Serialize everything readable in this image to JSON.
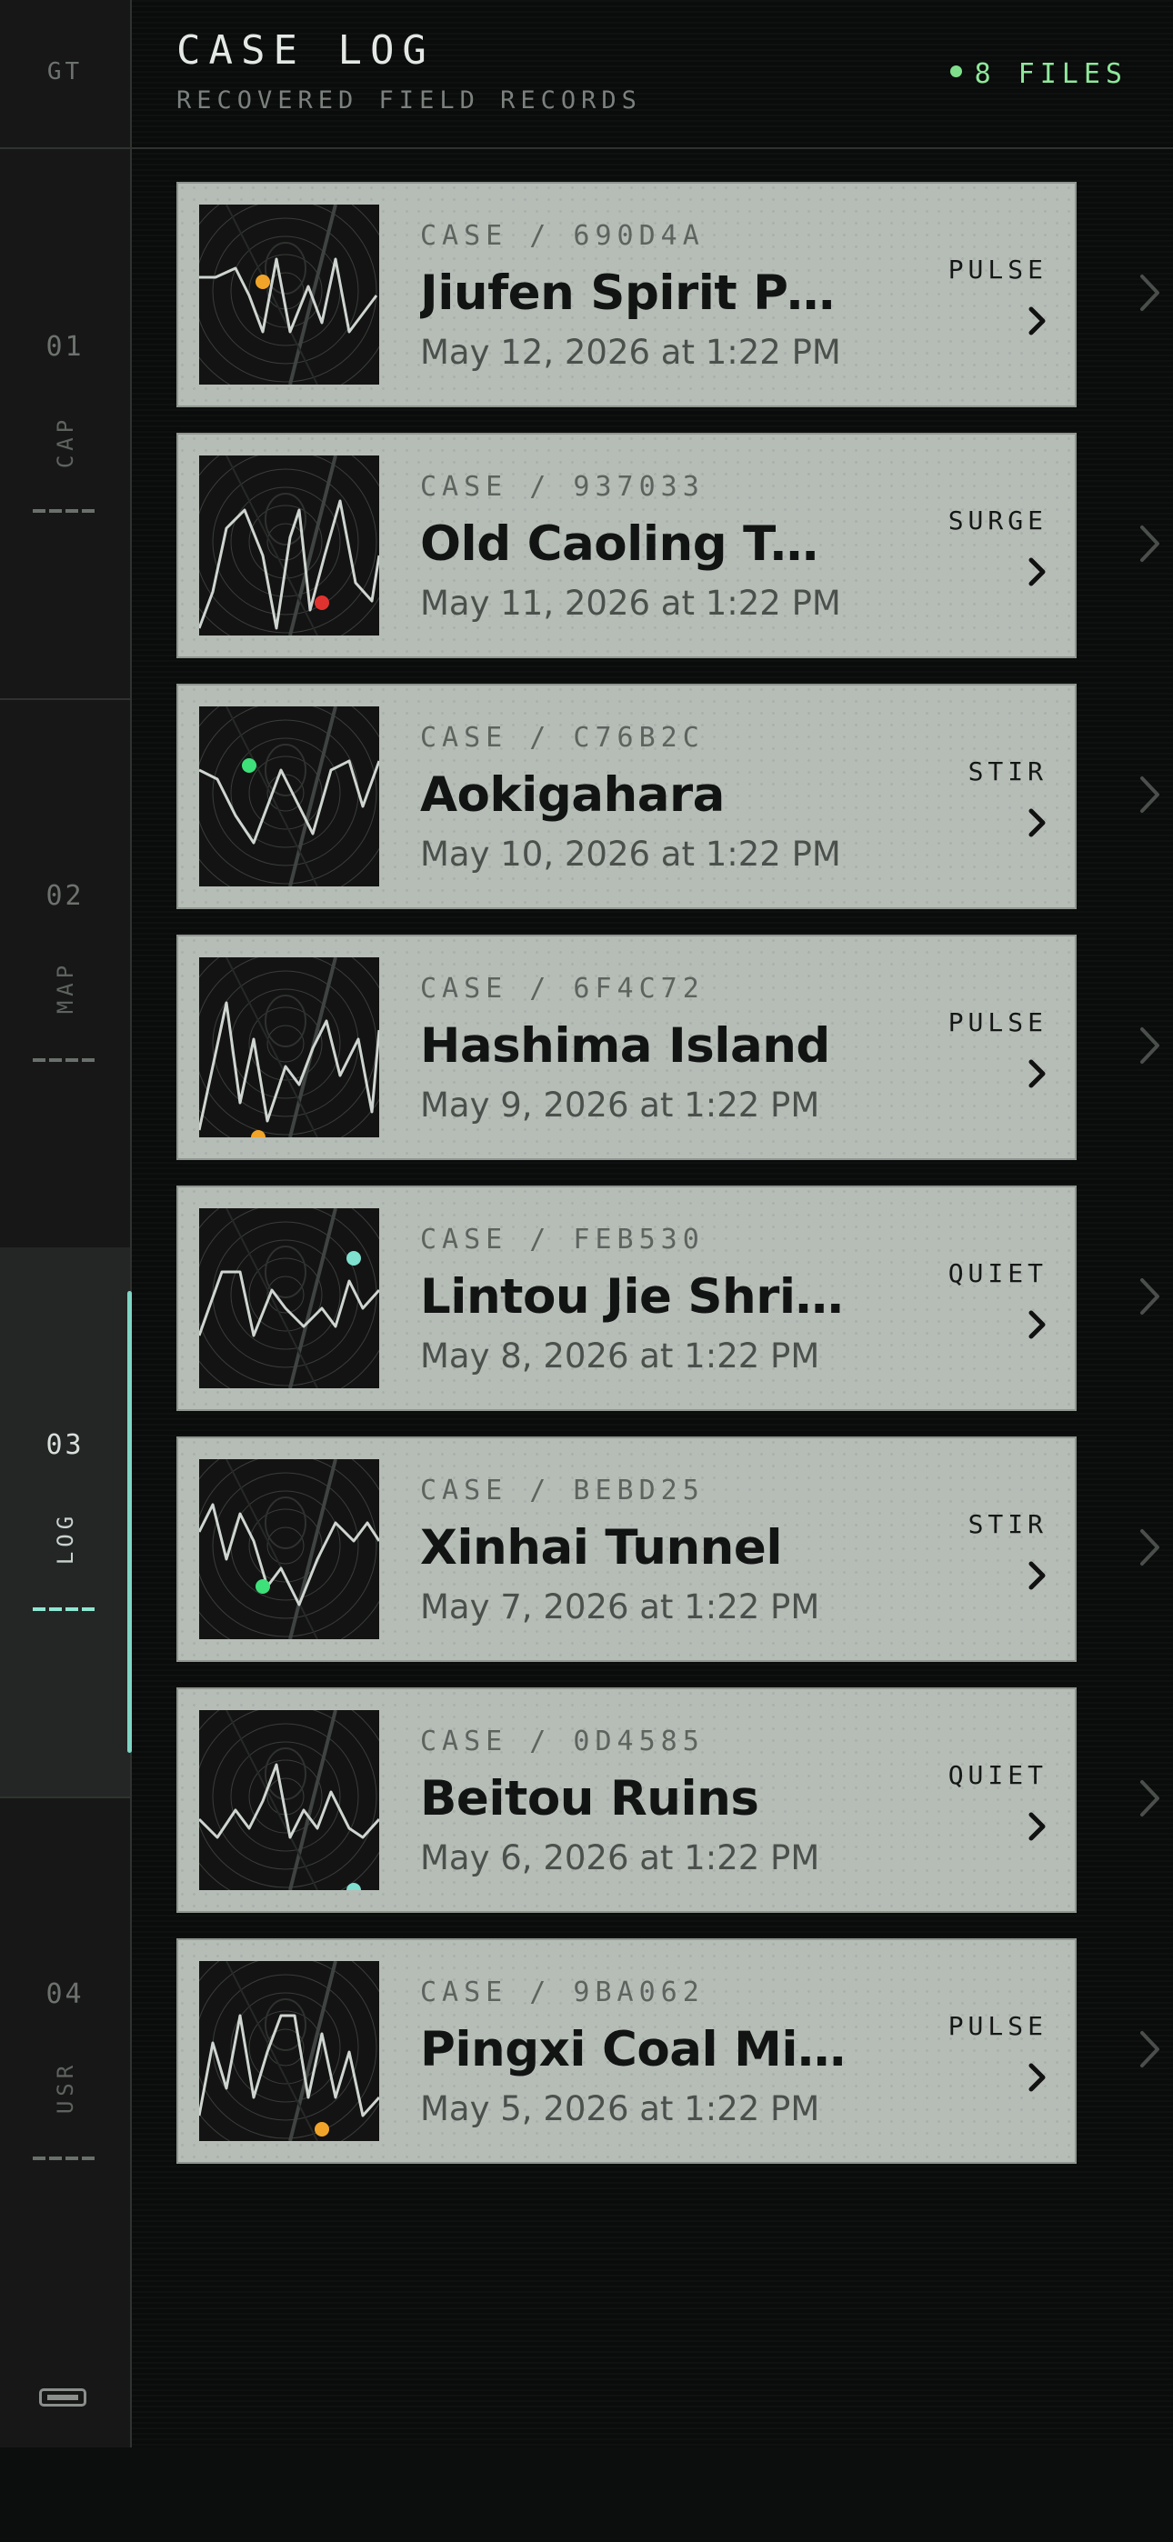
{
  "rail": {
    "top_label": "GT",
    "sections": [
      {
        "num": "01",
        "label": "CAP",
        "active": false
      },
      {
        "num": "02",
        "label": "MAP",
        "active": false
      },
      {
        "num": "03",
        "label": "LOG",
        "active": true
      },
      {
        "num": "04",
        "label": "USR",
        "active": false
      }
    ],
    "bottom_icon": "battery-icon"
  },
  "header": {
    "title": "CASE LOG",
    "subtitle": "RECOVERED FIELD RECORDS",
    "files_count": "8 FILES",
    "files_dot_color": "#7ee08b"
  },
  "cases": [
    {
      "id": "CASE / 690D4A",
      "title": "Jiufen Spirit Pass",
      "date": "May 12, 2026 at 1:22 PM",
      "status": "PULSE",
      "dot_color": "#f0a52a"
    },
    {
      "id": "CASE / 937033",
      "title": "Old Caoling Tunnel",
      "date": "May 11, 2026 at 1:22 PM",
      "status": "SURGE",
      "dot_color": "#e0332f"
    },
    {
      "id": "CASE / C76B2C",
      "title": "Aokigahara",
      "date": "May 10, 2026 at 1:22 PM",
      "status": "STIR",
      "dot_color": "#3ee07a"
    },
    {
      "id": "CASE / 6F4C72",
      "title": "Hashima Island",
      "date": "May 9, 2026 at 1:22 PM",
      "status": "PULSE",
      "dot_color": "#f0a52a"
    },
    {
      "id": "CASE / FEB530",
      "title": "Lintou Jie Shrine",
      "date": "May 8, 2026 at 1:22 PM",
      "status": "QUIET",
      "dot_color": "#7fe0d0"
    },
    {
      "id": "CASE / BEBD25",
      "title": "Xinhai Tunnel",
      "date": "May 7, 2026 at 1:22 PM",
      "status": "STIR",
      "dot_color": "#3ee07a"
    },
    {
      "id": "CASE / 0D4585",
      "title": "Beitou Ruins",
      "date": "May 6, 2026 at 1:22 PM",
      "status": "QUIET",
      "dot_color": "#7fe0d0"
    },
    {
      "id": "CASE / 9BA062",
      "title": "Pingxi Coal Mines",
      "date": "May 5, 2026 at 1:22 PM",
      "status": "PULSE",
      "dot_color": "#f0a52a"
    }
  ]
}
